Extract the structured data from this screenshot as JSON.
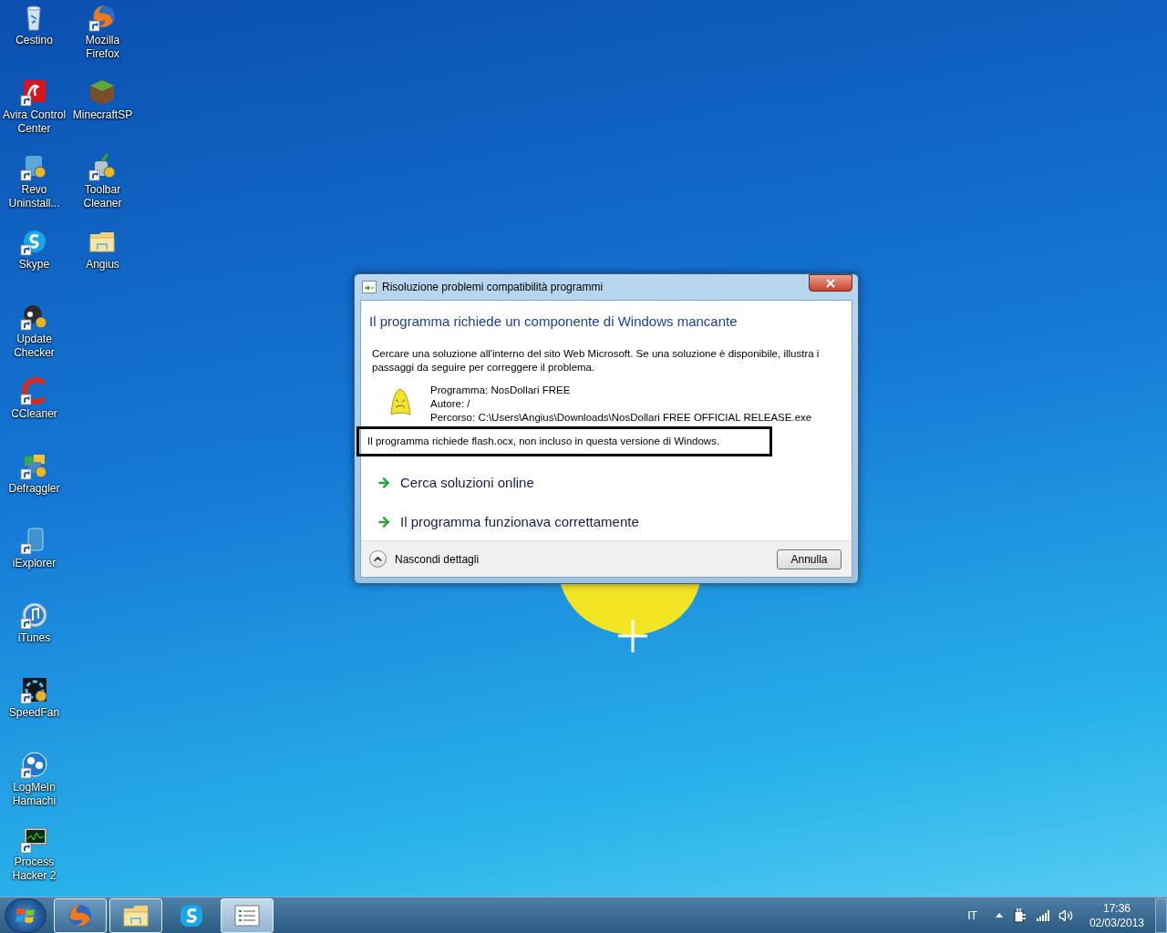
{
  "desktop": {
    "icon_columns": [
      [
        {
          "label": "Cestino"
        },
        {
          "label": "Avira Control Center"
        },
        {
          "label": "Revo Uninstall..."
        },
        {
          "label": "Skype"
        },
        {
          "label": "Update Checker"
        },
        {
          "label": "CCleaner"
        },
        {
          "label": "Defraggler"
        },
        {
          "label": "iExplorer"
        },
        {
          "label": "iTunes"
        },
        {
          "label": "SpeedFan"
        },
        {
          "label": "LogMeIn Hamachi"
        },
        {
          "label": "Process Hacker 2"
        }
      ],
      [
        {
          "label": "Mozilla Firefox"
        },
        {
          "label": "MinecraftSP"
        },
        {
          "label": "Toolbar Cleaner"
        },
        {
          "label": "Angius"
        }
      ]
    ]
  },
  "dialog": {
    "title": "Risoluzione problemi compatibilità programmi",
    "heading": "Il programma richiede un componente di Windows mancante",
    "description": "Cercare una soluzione all'interno del sito Web Microsoft. Se una soluzione è disponibile, illustra i passaggi da seguire per correggere il problema.",
    "details": [
      "Programma: NosDollari FREE",
      "Autore: /",
      "Percorso: C:\\Users\\Angius\\Downloads\\NosDollari FREE OFFICIAL RELEASE.exe"
    ],
    "highlighted_message": "Il programma richiede flash.ocx, non incluso in questa versione di Windows.",
    "options": [
      "Cerca soluzioni online",
      "Il programma funzionava correttamente"
    ],
    "details_toggle": {
      "label": "Nascondi dettagli",
      "expanded": true
    },
    "cancel_button": "Annulla"
  },
  "taskbar": {
    "buttons": [
      {
        "running": true,
        "selected": false
      },
      {
        "running": true,
        "selected": false
      },
      {
        "running": false,
        "selected": false
      },
      {
        "running": true,
        "selected": true
      }
    ],
    "language": "IT",
    "time": "17:36",
    "date": "02/03/2013"
  }
}
